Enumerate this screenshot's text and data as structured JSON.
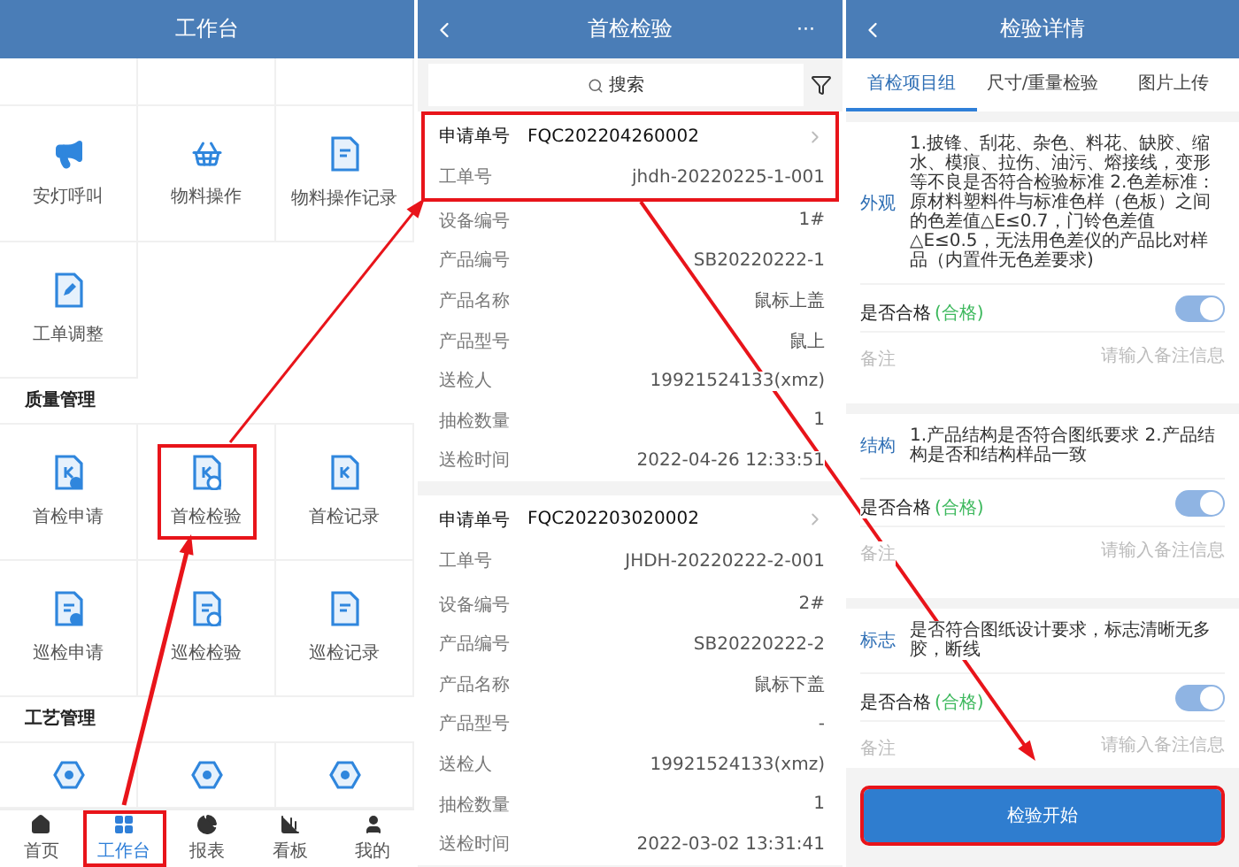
{
  "workbench": {
    "title": "工作台",
    "top_items": [
      {
        "label": "安灯呼叫"
      },
      {
        "label": "物料操作"
      },
      {
        "label": "物料操作记录"
      },
      {
        "label": "工单调整"
      }
    ],
    "sections": [
      {
        "title": "质量管理",
        "items": [
          {
            "label": "首检申请",
            "highlighted": false
          },
          {
            "label": "首检检验",
            "highlighted": true
          },
          {
            "label": "首检记录",
            "highlighted": false
          },
          {
            "label": "巡检申请",
            "highlighted": false
          },
          {
            "label": "巡检检验",
            "highlighted": false
          },
          {
            "label": "巡检记录",
            "highlighted": false
          }
        ]
      },
      {
        "title": "工艺管理"
      }
    ],
    "tabbar": [
      {
        "label": "首页",
        "selected": false,
        "highlighted": false
      },
      {
        "label": "工作台",
        "selected": true,
        "highlighted": true
      },
      {
        "label": "报表",
        "selected": false,
        "highlighted": false
      },
      {
        "label": "看板",
        "selected": false,
        "highlighted": false
      },
      {
        "label": "我的",
        "selected": false,
        "highlighted": false
      }
    ]
  },
  "inspection_list": {
    "title": "首检检验",
    "more": "···",
    "search": {
      "placeholder": "搜索"
    },
    "records": [
      {
        "order_label": "申请单号",
        "order_no": "FQC202204260002",
        "highlighted": true,
        "fields": [
          {
            "label": "工单号",
            "value": "jhdh-20220225-1-001"
          },
          {
            "label": "设备编号",
            "value": "1#"
          },
          {
            "label": "产品编号",
            "value": "SB20220222-1"
          },
          {
            "label": "产品名称",
            "value": "鼠标上盖"
          },
          {
            "label": "产品型号",
            "value": "鼠上"
          },
          {
            "label": "送检人",
            "value": "19921524133(xmz)"
          },
          {
            "label": "抽检数量",
            "value": "1"
          },
          {
            "label": "送检时间",
            "value": "2022-04-26 12:33:51"
          }
        ]
      },
      {
        "order_label": "申请单号",
        "order_no": "FQC202203020002",
        "highlighted": false,
        "fields": [
          {
            "label": "工单号",
            "value": "JHDH-20220222-2-001"
          },
          {
            "label": "设备编号",
            "value": "2#"
          },
          {
            "label": "产品编号",
            "value": "SB20220222-2"
          },
          {
            "label": "产品名称",
            "value": "鼠标下盖"
          },
          {
            "label": "产品型号",
            "value": "-"
          },
          {
            "label": "送检人",
            "value": "19921524133(xmz)"
          },
          {
            "label": "抽检数量",
            "value": "1"
          },
          {
            "label": "送检时间",
            "value": "2022-03-02 13:31:41"
          }
        ]
      }
    ]
  },
  "detail": {
    "title": "检验详情",
    "tabs": [
      {
        "label": "首检项目组",
        "selected": true
      },
      {
        "label": "尺寸/重量检验",
        "selected": false
      },
      {
        "label": "图片上传",
        "selected": false
      }
    ],
    "items": [
      {
        "name": "外观",
        "description": "1.披锋、刮花、杂色、料花、缺胶、缩水、模痕、拉伤、油污、熔接线，变形等不良是否符合检验标准 2.色差标准：原材料塑料件与标准色样（色板）之间的色差值△E≤0.7，门铃色差值△E≤0.5，无法用色差仪的产品比对样品（内置件无色差要求)",
        "pass_label": "是否合格",
        "result": "(合格)",
        "passed": true,
        "remark_label": "备注",
        "remark_placeholder": "请输入备注信息"
      },
      {
        "name": "结构",
        "description": "1.产品结构是否符合图纸要求 2.产品结构是否和结构样品一致",
        "pass_label": "是否合格",
        "result": "(合格)",
        "passed": true,
        "remark_label": "备注",
        "remark_placeholder": "请输入备注信息"
      },
      {
        "name": "标志",
        "description": "是否符合图纸设计要求，标志清晰无多胶，断线",
        "pass_label": "是否合格",
        "result": "(合格)",
        "passed": true,
        "remark_label": "备注",
        "remark_placeholder": "请输入备注信息"
      }
    ],
    "button": {
      "label": "检验开始",
      "highlighted": true
    }
  }
}
